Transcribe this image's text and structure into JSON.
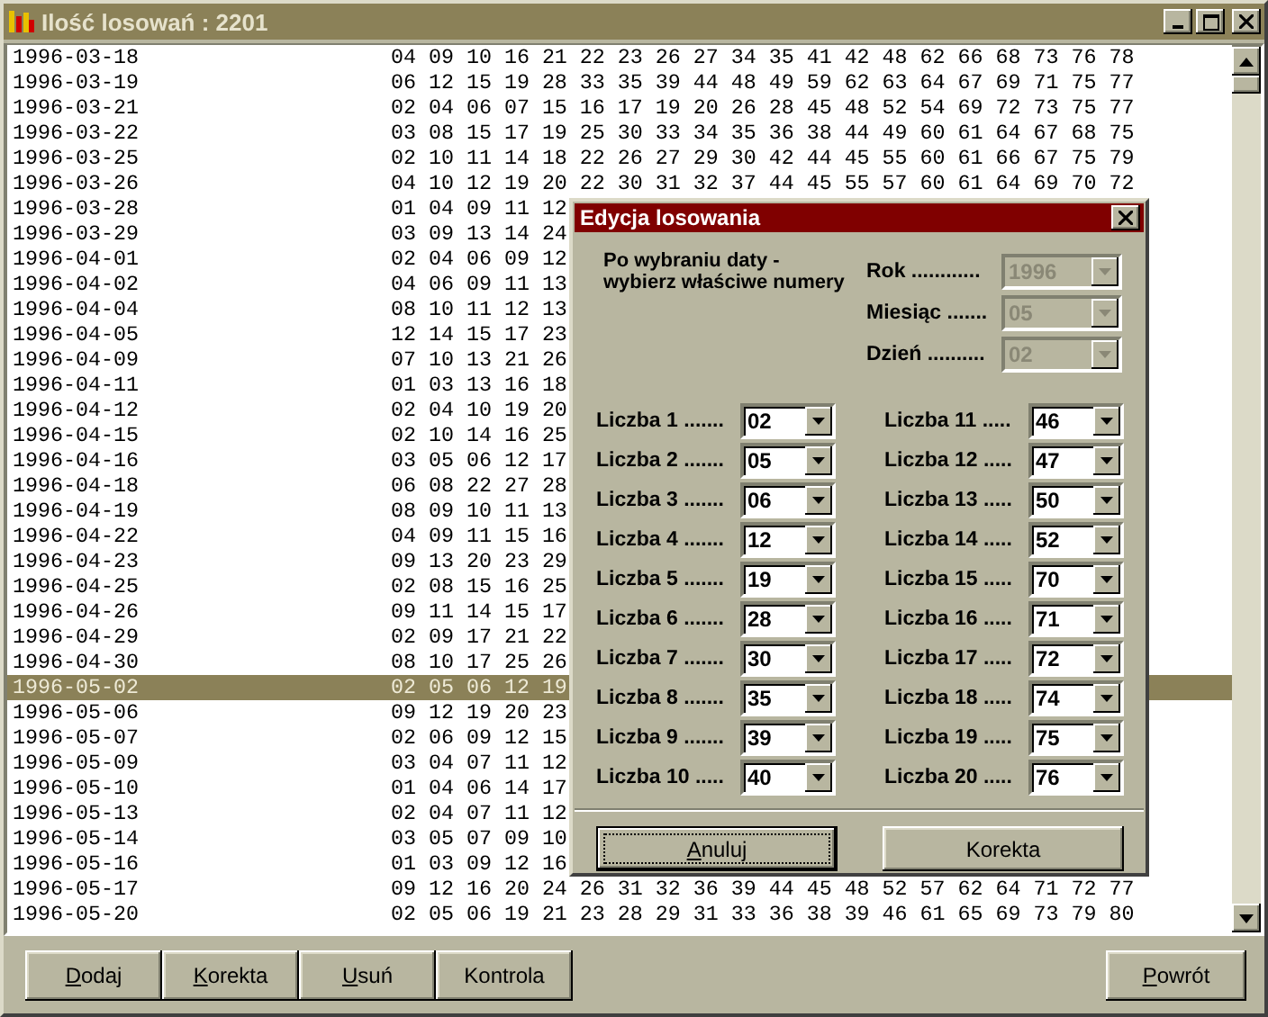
{
  "window": {
    "title": "Ilość losowań : 2201"
  },
  "draws": [
    {
      "date": "1996-03-18",
      "numbers": "04 09 10 16 21 22 23 26 27 34 35 41 42 48 62 66 68 73 76 78",
      "selected": false
    },
    {
      "date": "1996-03-19",
      "numbers": "06 12 15 19 28 33 35 39 44 48 49 59 62 63 64 67 69 71 75 77",
      "selected": false
    },
    {
      "date": "1996-03-21",
      "numbers": "02 04 06 07 15 16 17 19 20 26 28 45 48 52 54 69 72 73 75 77",
      "selected": false
    },
    {
      "date": "1996-03-22",
      "numbers": "03 08 15 17 19 25 30 33 34 35 36 38 44 49 60 61 64 67 68 75",
      "selected": false
    },
    {
      "date": "1996-03-25",
      "numbers": "02 10 11 14 18 22 26 27 29 30 42 44 45 55 60 61 66 67 75 79",
      "selected": false
    },
    {
      "date": "1996-03-26",
      "numbers": "04 10 12 19 20 22 30 31 32 37 44 45 55 57 60 61 64 69 70 72",
      "selected": false
    },
    {
      "date": "1996-03-28",
      "numbers": "01 04 09 11 12",
      "selected": false
    },
    {
      "date": "1996-03-29",
      "numbers": "03 09 13 14 24",
      "selected": false
    },
    {
      "date": "1996-04-01",
      "numbers": "02 04 06 09 12",
      "selected": false
    },
    {
      "date": "1996-04-02",
      "numbers": "04 06 09 11 13",
      "selected": false
    },
    {
      "date": "1996-04-04",
      "numbers": "08 10 11 12 13",
      "selected": false
    },
    {
      "date": "1996-04-05",
      "numbers": "12 14 15 17 23",
      "selected": false
    },
    {
      "date": "1996-04-09",
      "numbers": "07 10 13 21 26",
      "selected": false
    },
    {
      "date": "1996-04-11",
      "numbers": "01 03 13 16 18",
      "selected": false
    },
    {
      "date": "1996-04-12",
      "numbers": "02 04 10 19 20",
      "selected": false
    },
    {
      "date": "1996-04-15",
      "numbers": "02 10 14 16 25",
      "selected": false
    },
    {
      "date": "1996-04-16",
      "numbers": "03 05 06 12 17",
      "selected": false
    },
    {
      "date": "1996-04-18",
      "numbers": "06 08 22 27 28",
      "selected": false
    },
    {
      "date": "1996-04-19",
      "numbers": "08 09 10 11 13",
      "selected": false
    },
    {
      "date": "1996-04-22",
      "numbers": "04 09 11 15 16",
      "selected": false
    },
    {
      "date": "1996-04-23",
      "numbers": "09 13 20 23 29",
      "selected": false
    },
    {
      "date": "1996-04-25",
      "numbers": "02 08 15 16 25",
      "selected": false
    },
    {
      "date": "1996-04-26",
      "numbers": "09 11 14 15 17",
      "selected": false
    },
    {
      "date": "1996-04-29",
      "numbers": "02 09 17 21 22",
      "selected": false
    },
    {
      "date": "1996-04-30",
      "numbers": "08 10 17 25 26",
      "selected": false
    },
    {
      "date": "1996-05-02",
      "numbers": "02 05 06 12 19",
      "selected": true
    },
    {
      "date": "1996-05-06",
      "numbers": "09 12 19 20 23",
      "selected": false
    },
    {
      "date": "1996-05-07",
      "numbers": "02 06 09 12 15",
      "selected": false
    },
    {
      "date": "1996-05-09",
      "numbers": "03 04 07 11 12",
      "selected": false
    },
    {
      "date": "1996-05-10",
      "numbers": "01 04 06 14 17",
      "selected": false
    },
    {
      "date": "1996-05-13",
      "numbers": "02 04 07 11 12",
      "selected": false
    },
    {
      "date": "1996-05-14",
      "numbers": "03 05 07 09 10",
      "selected": false
    },
    {
      "date": "1996-05-16",
      "numbers": "01 03 09 12 16",
      "selected": false
    },
    {
      "date": "1996-05-17",
      "numbers": "09 12 16 20 24 26 31 32 36 39 44 45 48 52 57 62 64 71 72 77",
      "selected": false
    },
    {
      "date": "1996-05-20",
      "numbers": "02 05 06 19 21 23 28 29 31 33 36 38 39 46 61 65 69 73 79 80",
      "selected": false
    }
  ],
  "dialog": {
    "title": "Edycja losowania",
    "hint": "Po wybraniu daty - wybierz właściwe numery",
    "date_fields": [
      {
        "label": "Rok ............",
        "value": "1996",
        "disabled": true
      },
      {
        "label": "Miesiąc .......",
        "value": "05",
        "disabled": true
      },
      {
        "label": "Dzień ..........",
        "value": "02",
        "disabled": true
      }
    ],
    "number_fields": [
      {
        "label": "Liczba 1 .......",
        "value": "02"
      },
      {
        "label": "Liczba 2 .......",
        "value": "05"
      },
      {
        "label": "Liczba 3 .......",
        "value": "06"
      },
      {
        "label": "Liczba 4 .......",
        "value": "12"
      },
      {
        "label": "Liczba 5 .......",
        "value": "19"
      },
      {
        "label": "Liczba 6 .......",
        "value": "28"
      },
      {
        "label": "Liczba 7 .......",
        "value": "30"
      },
      {
        "label": "Liczba 8 .......",
        "value": "35"
      },
      {
        "label": "Liczba 9 .......",
        "value": "39"
      },
      {
        "label": "Liczba 10 .....",
        "value": "40"
      },
      {
        "label": "Liczba 11 .....",
        "value": "46"
      },
      {
        "label": "Liczba 12 .....",
        "value": "47"
      },
      {
        "label": "Liczba 13 .....",
        "value": "50"
      },
      {
        "label": "Liczba 14 .....",
        "value": "52"
      },
      {
        "label": "Liczba 15 .....",
        "value": "70"
      },
      {
        "label": "Liczba 16 .....",
        "value": "71"
      },
      {
        "label": "Liczba 17 .....",
        "value": "72"
      },
      {
        "label": "Liczba 18 .....",
        "value": "74"
      },
      {
        "label": "Liczba 19 .....",
        "value": "75"
      },
      {
        "label": "Liczba 20 .....",
        "value": "76"
      }
    ],
    "buttons": [
      {
        "label": "Anuluj",
        "mnemonic": true,
        "focused": true
      },
      {
        "label": "Korekta",
        "mnemonic": false,
        "focused": false
      }
    ]
  },
  "toolbar": [
    {
      "label": "Dodaj",
      "mnemonic": true
    },
    {
      "label": "Korekta",
      "mnemonic": true
    },
    {
      "label": "Usuń",
      "mnemonic": true
    },
    {
      "label": "Kontrola",
      "mnemonic": false
    }
  ],
  "return_button": {
    "label": "Powrót",
    "mnemonic": true
  }
}
